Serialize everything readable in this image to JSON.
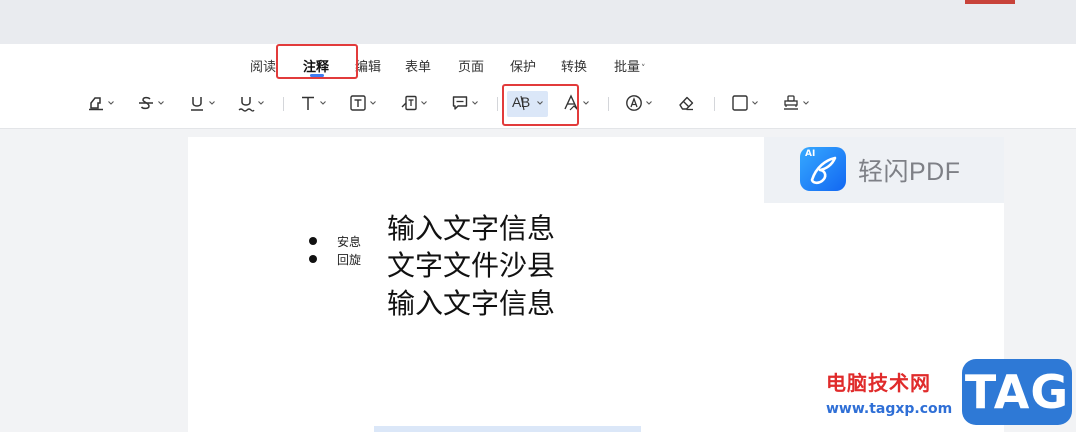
{
  "ribbon": {
    "tabs": [
      {
        "label": "阅读"
      },
      {
        "label": "注释"
      },
      {
        "label": "编辑"
      },
      {
        "label": "表单"
      },
      {
        "label": "页面"
      },
      {
        "label": "保护"
      },
      {
        "label": "转换"
      },
      {
        "label": "批量"
      }
    ],
    "active_tab": "注释",
    "tools": [
      "highlight-icon",
      "strikethrough-icon",
      "underline-icon",
      "wavy-underline-icon",
      "text-icon",
      "textbox-icon",
      "callout-icon",
      "comment-icon",
      "replace-text-icon",
      "insert-text-icon",
      "area-highlight-icon",
      "eraser-icon",
      "rectangle-icon",
      "stamp-icon"
    ],
    "selected_tool": "replace-text-icon",
    "replace_text_label": "AB"
  },
  "brand": {
    "ai": "AI",
    "name": "轻闪PDF"
  },
  "document": {
    "bullets": [
      "安息",
      "回旋"
    ],
    "lines": [
      "输入文字信息",
      "文字文件沙县",
      "输入文字信息"
    ]
  },
  "watermark": {
    "title": "电脑技术网",
    "url": "www.tagxp.com",
    "tag": "TAG"
  },
  "colors": {
    "accent": "#3f7cf0",
    "highlight_box": "#e23b3b",
    "tool_selected_bg": "#dbe7f8"
  }
}
